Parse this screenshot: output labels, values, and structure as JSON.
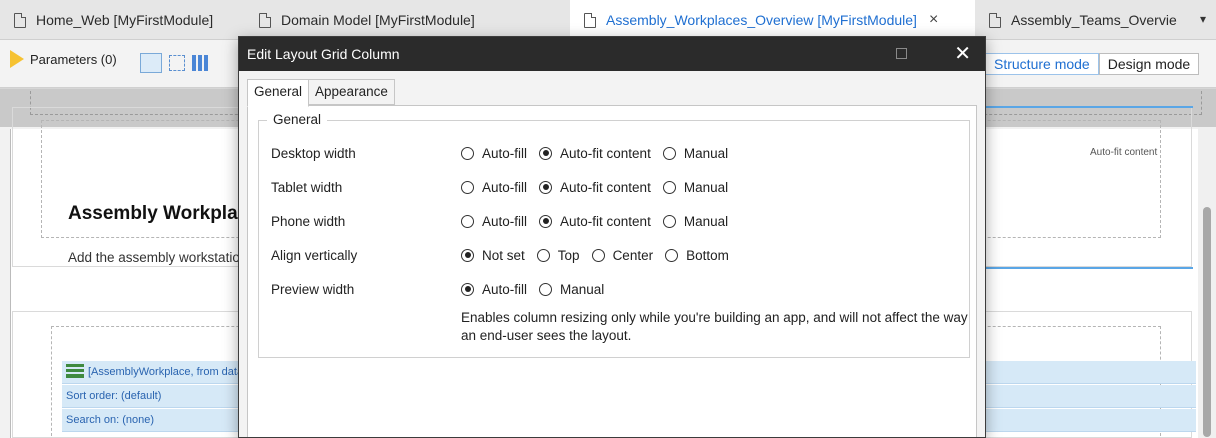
{
  "tabs": [
    {
      "label": "Home_Web [MyFirstModule]",
      "active": false
    },
    {
      "label": "Domain Model [MyFirstModule]",
      "active": false
    },
    {
      "label": "Assembly_Workplaces_Overview [MyFirstModule]",
      "active": true,
      "close": "×"
    },
    {
      "label": "Assembly_Teams_Overvie",
      "active": false
    }
  ],
  "tab_overflow": "▾",
  "toolbar": {
    "parameters_label": "Parameters (0)",
    "structure_mode": "Structure mode",
    "design_mode": "Design mode"
  },
  "canvas": {
    "page_title": "Assembly Workplaces Overview",
    "page_subtitle": "Add the assembly workstations",
    "autofit_label": "Auto-fit content",
    "list_rows": [
      "[AssemblyWorkplace, from database]",
      "Sort order: (default)",
      "Search on: (none)"
    ]
  },
  "dialog": {
    "title": "Edit Layout Grid Column",
    "close_glyph": "✕",
    "tabs": [
      "General",
      "Appearance"
    ],
    "group_label": "General",
    "rows": [
      {
        "label": "Desktop width",
        "options": [
          "Auto-fill",
          "Auto-fit content",
          "Manual"
        ],
        "selected": 1
      },
      {
        "label": "Tablet width",
        "options": [
          "Auto-fill",
          "Auto-fit content",
          "Manual"
        ],
        "selected": 1
      },
      {
        "label": "Phone width",
        "options": [
          "Auto-fill",
          "Auto-fit content",
          "Manual"
        ],
        "selected": 1
      },
      {
        "label": "Align vertically",
        "options": [
          "Not set",
          "Top",
          "Center",
          "Bottom"
        ],
        "selected": 0
      },
      {
        "label": "Preview width",
        "options": [
          "Auto-fill",
          "Manual"
        ],
        "selected": 0
      }
    ],
    "help_text": "Enables column resizing only while you're building an app, and will not affect the way an end-user sees the layout."
  },
  "colors": {
    "accent": "#1f6fd1",
    "dialog_title_bg": "#2b2b2b",
    "list_row_bg": "#d6e9f7"
  }
}
